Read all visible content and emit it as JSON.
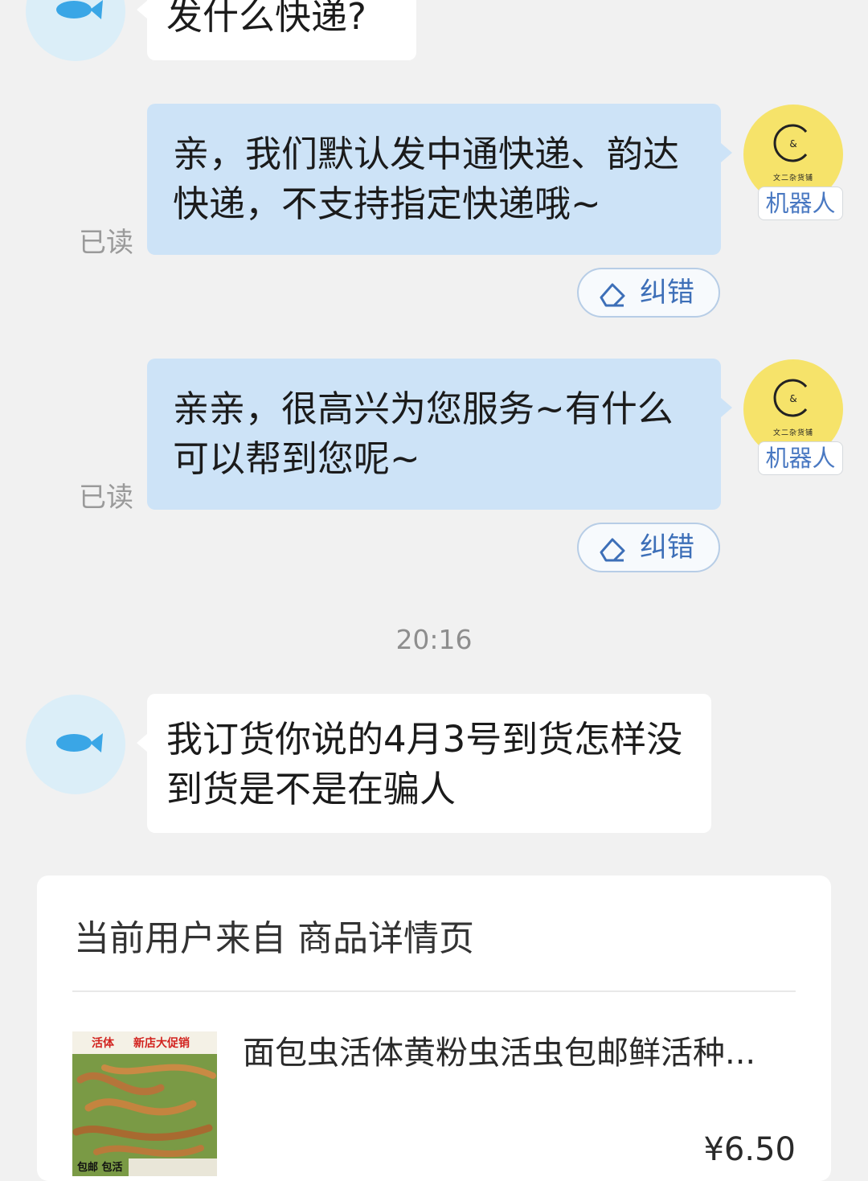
{
  "messages": [
    {
      "sender": "user",
      "text": "发什么快递?"
    },
    {
      "sender": "bot",
      "text": "亲，我们默认发中通快递、韵达快递，不支持指定快递哦~",
      "status": "已读",
      "action": "纠错",
      "tag": "机器人",
      "shop_name": "文二杂货铺"
    },
    {
      "sender": "bot",
      "text": "亲亲，很高兴为您服务~有什么可以帮到您呢~",
      "status": "已读",
      "action": "纠错",
      "tag": "机器人",
      "shop_name": "文二杂货铺"
    },
    {
      "sender": "user",
      "text": "我订货你说的4月3号到货怎样没到货是不是在骗人"
    }
  ],
  "timestamp": "20:16",
  "product_card": {
    "origin_label": "当前用户来自 商品详情页",
    "title": "面包虫活体黄粉虫活虫包邮鲜活种...",
    "price": "¥6.50",
    "thumb_badges": [
      "活体",
      "新店大促销",
      "包邮 包活"
    ]
  },
  "colors": {
    "background": "#f1f1f1",
    "bot_bubble": "#cde3f7",
    "user_bubble": "#ffffff",
    "accent_blue": "#3d6fb8",
    "bot_avatar": "#f6e36a"
  }
}
